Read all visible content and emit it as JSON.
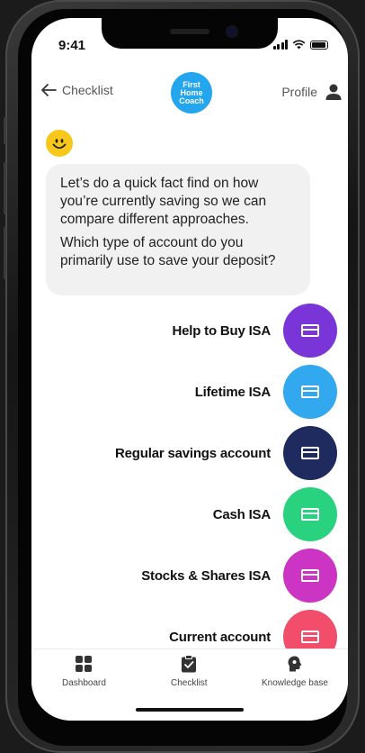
{
  "status_bar": {
    "time": "9:41"
  },
  "header": {
    "back_label": "Checklist",
    "logo_text": "First Home Coach",
    "profile_label": "Profile"
  },
  "chat": {
    "message_lines": [
      "Let’s do a quick fact find on how you’re currently saving so we can compare different approaches.",
      "Which type of account do you primarily use to save your deposit?"
    ]
  },
  "options": [
    {
      "label": "Help to Buy ISA",
      "color": "#7a35d9"
    },
    {
      "label": "Lifetime ISA",
      "color": "#32a8ee"
    },
    {
      "label": "Regular savings account",
      "color": "#1f2a5e"
    },
    {
      "label": "Cash ISA",
      "color": "#28d27e"
    },
    {
      "label": "Stocks & Shares ISA",
      "color": "#cc35c4"
    },
    {
      "label": "Current account",
      "color": "#f24d6b"
    }
  ],
  "tabbar": {
    "items": [
      {
        "label": "Dashboard",
        "icon": "grid-icon"
      },
      {
        "label": "Checklist",
        "icon": "clipboard-check-icon"
      },
      {
        "label": "Knowledge base",
        "icon": "head-icon"
      }
    ]
  }
}
